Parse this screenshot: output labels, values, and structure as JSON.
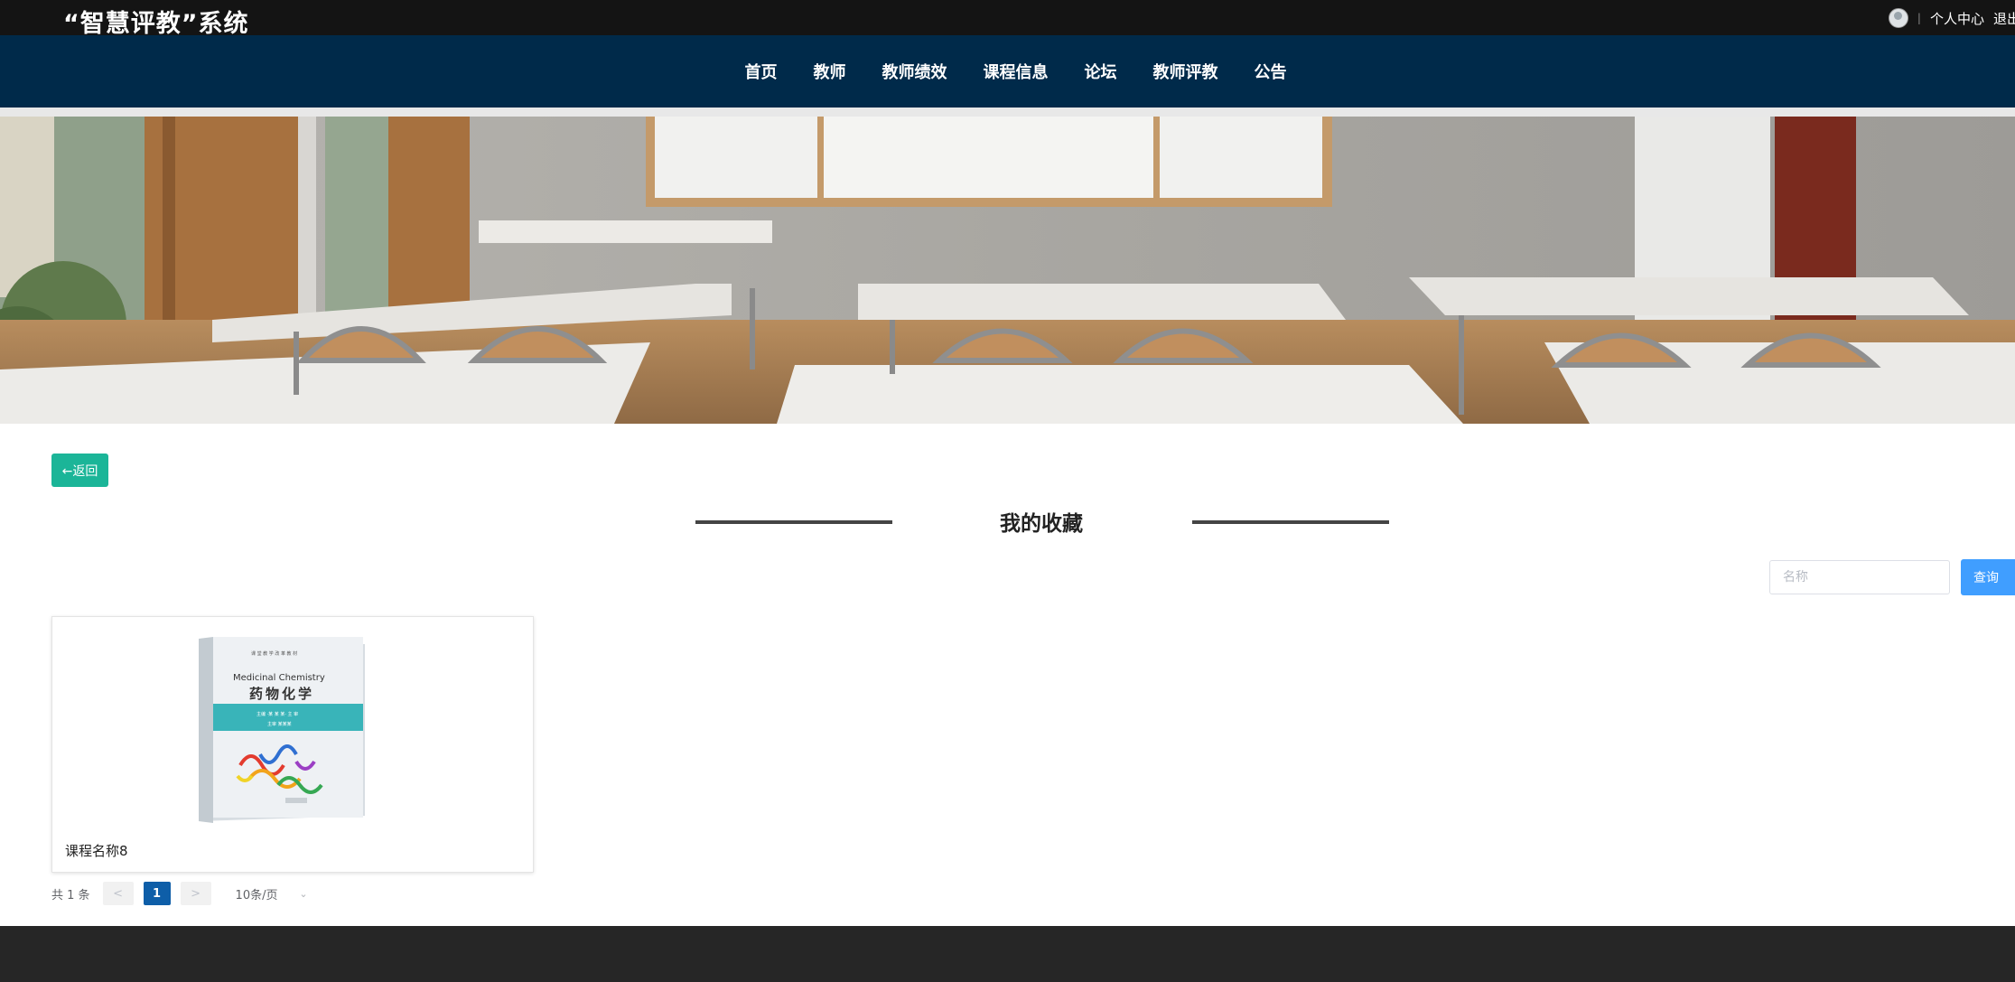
{
  "header": {
    "site_title": "“智慧评教”系统",
    "separator": "|",
    "profile_link": "个人中心",
    "logout_link": "退出"
  },
  "nav": {
    "items": [
      "首页",
      "教师",
      "教师绩效",
      "课程信息",
      "论坛",
      "教师评教",
      "公告"
    ]
  },
  "banner": {
    "slide_count": 3,
    "active_slide": 1,
    "accent_color": "#f35845"
  },
  "page": {
    "back_label": "←返回",
    "section_title": "我的收藏"
  },
  "search": {
    "placeholder": "名称",
    "value": "",
    "button_label": "查询"
  },
  "favorites": [
    {
      "name": "课程名称8",
      "cover": {
        "title_en": "Medicinal Chemistry",
        "title_cn": "药物化学",
        "series": "课 堂 教 学 改 革 教 材",
        "authors": "主编 ·某 某 某· 主 审",
        "editor": "主审 某某某"
      }
    }
  ],
  "pagination": {
    "total_text": "共 1 条",
    "prev": "<",
    "next": ">",
    "current_page": "1",
    "page_size": "10条/页",
    "active_color": "#0e5ea8"
  },
  "colors": {
    "topbar": "#141414",
    "navbar": "#002a4a",
    "back_button": "#1bb598",
    "search_button": "#409eff",
    "footer": "#262626"
  }
}
